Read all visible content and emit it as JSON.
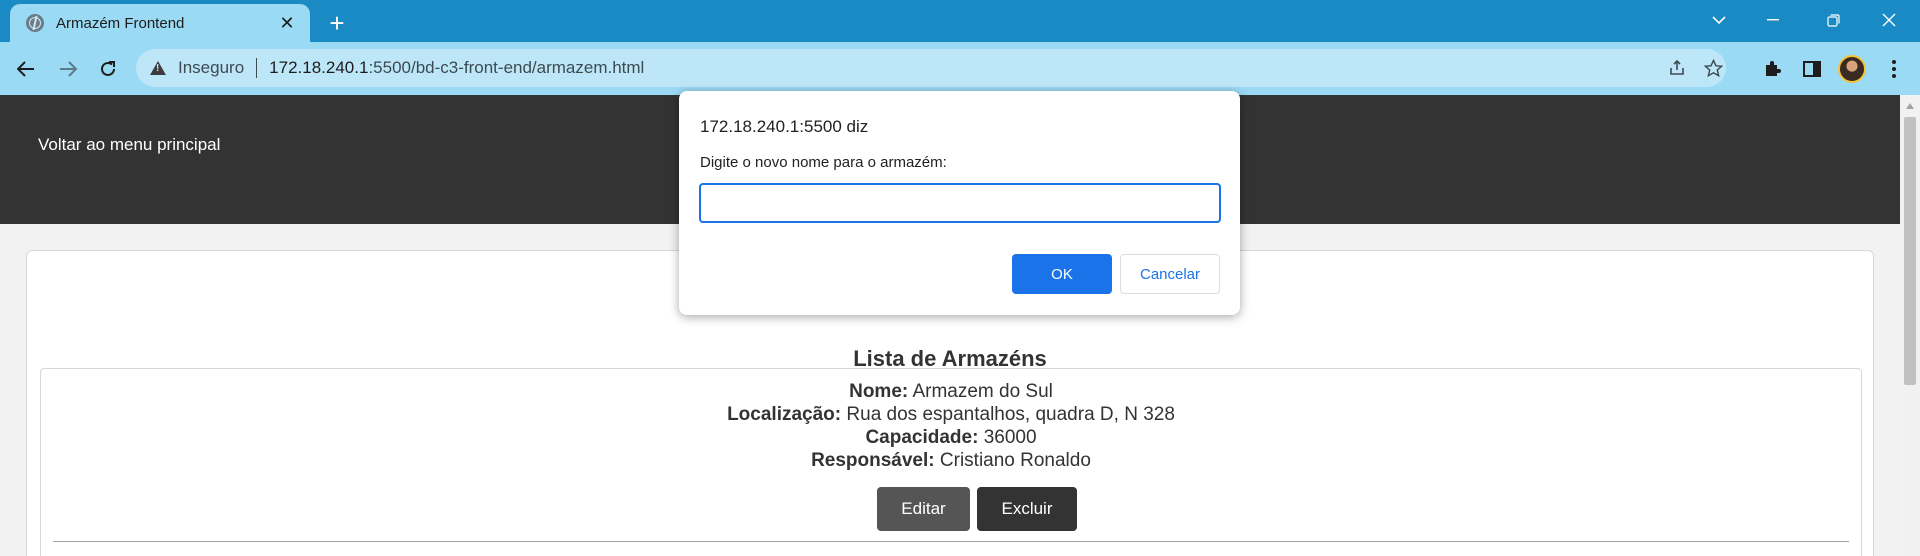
{
  "browser": {
    "tab_title": "Armazém Frontend",
    "tab_close_glyph": "✕",
    "new_tab_glyph": "+",
    "security_label": "Inseguro",
    "url_host": "172.18.240.1",
    "url_path": ":5500/bd-c3-front-end/armazem.html",
    "icons": [
      "back-icon",
      "forward-icon",
      "reload-icon",
      "warning-icon",
      "share-icon",
      "star-icon",
      "extensions-icon",
      "sidepanel-icon",
      "profile-avatar",
      "menu-icon",
      "minimize-icon",
      "restore-icon",
      "close-icon",
      "tab-search-icon"
    ]
  },
  "page": {
    "back_link": "Voltar ao menu principal",
    "list_title": "Lista de Armazéns",
    "warehouse": {
      "name_label": "Nome:",
      "name": "Armazem do Sul",
      "location_label": "Localização:",
      "location": "Rua dos espantalhos, quadra D, N 328",
      "capacity_label": "Capacidade:",
      "capacity": "36000",
      "responsible_label": "Responsável:",
      "responsible": "Cristiano Ronaldo",
      "edit_label": "Editar",
      "delete_label": "Excluir"
    }
  },
  "dialog": {
    "origin": "172.18.240.1:5500 diz",
    "message": "Digite o novo nome para o armazém:",
    "input_value": "",
    "ok_label": "OK",
    "cancel_label": "Cancelar"
  },
  "colors": {
    "tabstrip": "#1a8ac4",
    "toolbar": "#9bdaf4",
    "header": "#333333",
    "accent": "#1a73e8"
  }
}
